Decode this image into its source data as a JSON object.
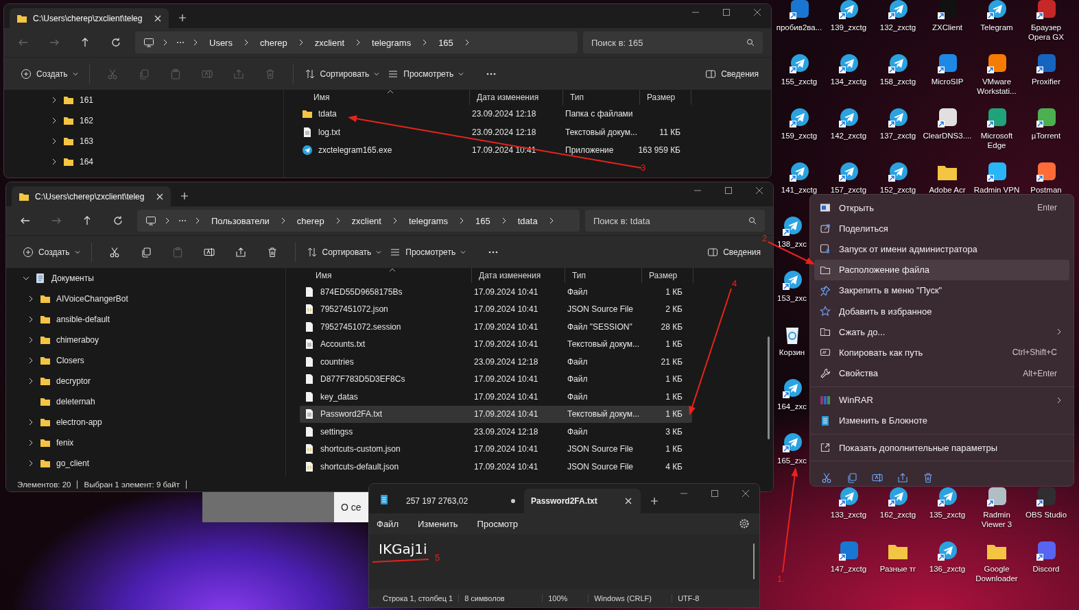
{
  "desktop": {
    "top_icons": [
      {
        "label": "пробив2ва...",
        "kind": "app",
        "color": "#1976d2"
      },
      {
        "label": "139_zxctg",
        "kind": "telegram"
      },
      {
        "label": "132_zxctg",
        "kind": "telegram"
      },
      {
        "label": "ZXClient",
        "kind": "app",
        "color": "#111111"
      },
      {
        "label": "Telegram",
        "kind": "telegram"
      },
      {
        "label": "Браузер Opera GX",
        "kind": "app",
        "color": "#c62828"
      },
      {
        "label": "155_zxctg",
        "kind": "telegram"
      },
      {
        "label": "134_zxctg",
        "kind": "telegram"
      },
      {
        "label": "158_zxctg",
        "kind": "telegram"
      },
      {
        "label": "MicroSIP",
        "kind": "app",
        "color": "#1e88e5"
      },
      {
        "label": "VMware Workstati...",
        "kind": "app",
        "color": "#f57c00"
      },
      {
        "label": "Proxifier",
        "kind": "app",
        "color": "#1565c0"
      },
      {
        "label": "159_zxctg",
        "kind": "telegram"
      },
      {
        "label": "142_zxctg",
        "kind": "telegram"
      },
      {
        "label": "137_zxctg",
        "kind": "telegram"
      },
      {
        "label": "ClearDNS3....",
        "kind": "app",
        "color": "#e0e0e0"
      },
      {
        "label": "Microsoft Edge",
        "kind": "app",
        "color": "#1fa37a"
      },
      {
        "label": "µTorrent",
        "kind": "app",
        "color": "#4caf50"
      },
      {
        "label": "141_zxctg",
        "kind": "telegram"
      },
      {
        "label": "157_zxctg",
        "kind": "telegram"
      },
      {
        "label": "152_zxctg",
        "kind": "telegram"
      },
      {
        "label": "Adobe Acr",
        "kind": "folder"
      },
      {
        "label": "Radmin VPN",
        "kind": "app",
        "color": "#29b6f6"
      },
      {
        "label": "Postman",
        "kind": "app",
        "color": "#ff6c37"
      }
    ],
    "left_icons": [
      {
        "label": "138_zxc",
        "kind": "telegram"
      },
      {
        "label": "153_zxc",
        "kind": "telegram"
      },
      {
        "label": "Корзин",
        "kind": "recycle-bin"
      },
      {
        "label": "164_zxc",
        "kind": "telegram"
      },
      {
        "label": "165_zxc",
        "kind": "telegram"
      }
    ],
    "bottom_icons": [
      {
        "label": "133_zxctg",
        "kind": "telegram"
      },
      {
        "label": "162_zxctg",
        "kind": "telegram"
      },
      {
        "label": "135_zxctg",
        "kind": "telegram"
      },
      {
        "label": "Radmin Viewer 3",
        "kind": "app",
        "color": "#b0bec5"
      },
      {
        "label": "OBS Studio",
        "kind": "app",
        "color": "#302e31"
      },
      {
        "label": "147_zxctg",
        "kind": "app",
        "color": "#1976d2"
      },
      {
        "label": "Разные тг",
        "kind": "folder"
      },
      {
        "label": "136_zxctg",
        "kind": "telegram"
      },
      {
        "label": "Google Downloader",
        "kind": "folder"
      },
      {
        "label": "Discord",
        "kind": "app",
        "color": "#5865f2"
      }
    ]
  },
  "explorer_windows": [
    {
      "tab_title": "C:\\Users\\cherep\\zxclient\\teleg",
      "nav": [
        {
          "disabled": true
        },
        {
          "disabled": true
        },
        {
          "disabled": false
        },
        {
          "disabled": false
        }
      ],
      "breadcrumbs": [
        "Users",
        "cherep",
        "zxclient",
        "telegrams",
        "165"
      ],
      "search": {
        "placeholder": "Поиск в: 165"
      },
      "toolbar": {
        "create": "Создать",
        "actions": [
          {
            "disabled": true
          },
          {
            "disabled": true
          },
          {
            "disabled": true
          },
          {
            "disabled": true
          },
          {
            "disabled": true
          },
          {
            "disabled": true
          }
        ],
        "sort": "Сортировать",
        "view": "Просмотреть",
        "details": "Сведения"
      },
      "tree": [
        {
          "label": "161",
          "kind": "folder",
          "expandable": true,
          "expanded": false
        },
        {
          "label": "162",
          "kind": "folder",
          "expandable": true,
          "expanded": false
        },
        {
          "label": "163",
          "kind": "folder",
          "expandable": true,
          "expanded": false
        },
        {
          "label": "164",
          "kind": "folder",
          "expandable": true,
          "expanded": false
        }
      ],
      "columns": [
        "Имя",
        "Дата изменения",
        "Тип",
        "Размер"
      ],
      "rows": [
        {
          "name": "tdata",
          "date": "23.09.2024 12:18",
          "type": "Папка с файлами",
          "kind": "folder",
          "selected": false
        },
        {
          "name": "log.txt",
          "date": "23.09.2024 12:18",
          "type": "Текстовый докум...",
          "size": "11 КБ",
          "kind": "text",
          "selected": false
        },
        {
          "name": "zxctelegram165.exe",
          "date": "17.09.2024 10:41",
          "type": "Приложение",
          "size": "163 959 КБ",
          "kind": "app",
          "selected": false
        }
      ]
    },
    {
      "tab_title": "C:\\Users\\cherep\\zxclient\\teleg",
      "nav": [
        {
          "disabled": false
        },
        {
          "disabled": true
        },
        {
          "disabled": false
        },
        {
          "disabled": false
        }
      ],
      "breadcrumbs": [
        "Пользователи",
        "cherep",
        "zxclient",
        "telegrams",
        "165",
        "tdata"
      ],
      "search": {
        "placeholder": "Поиск в: tdata"
      },
      "toolbar": {
        "create": "Создать",
        "actions": [
          {
            "disabled": false
          },
          {
            "disabled": false
          },
          {
            "disabled": true
          },
          {
            "disabled": false
          },
          {
            "disabled": false
          },
          {
            "disabled": false
          }
        ],
        "sort": "Сортировать",
        "view": "Просмотреть",
        "details": "Сведения"
      },
      "tree": [
        {
          "label": "Документы",
          "kind": "library",
          "expandable": true,
          "expanded": true,
          "children": [
            {
              "label": "AIVoiceChangerBot",
              "kind": "folder",
              "expandable": true
            },
            {
              "label": "ansible-default",
              "kind": "folder",
              "expandable": true
            },
            {
              "label": "chimeraboy",
              "kind": "folder",
              "expandable": true
            },
            {
              "label": "Closers",
              "kind": "folder",
              "expandable": true
            },
            {
              "label": "decryptor",
              "kind": "folder",
              "expandable": true
            },
            {
              "label": "deleternah",
              "kind": "folder",
              "expandable": false
            },
            {
              "label": "electron-app",
              "kind": "folder",
              "expandable": true
            },
            {
              "label": "fenix",
              "kind": "folder",
              "expandable": true
            },
            {
              "label": "go_client",
              "kind": "folder",
              "expandable": true
            }
          ]
        }
      ],
      "columns": [
        "Имя",
        "Дата изменения",
        "Тип",
        "Размер"
      ],
      "rows": [
        {
          "name": "874ED55D9658175Bs",
          "date": "17.09.2024 10:41",
          "type": "Файл",
          "size": "1 КБ",
          "kind": "file",
          "selected": false
        },
        {
          "name": "79527451072.json",
          "date": "17.09.2024 10:41",
          "type": "JSON Source File",
          "size": "2 КБ",
          "kind": "json",
          "selected": false
        },
        {
          "name": "79527451072.session",
          "date": "17.09.2024 10:41",
          "type": "Файл \"SESSION\"",
          "size": "28 КБ",
          "kind": "file",
          "selected": false
        },
        {
          "name": "Accounts.txt",
          "date": "17.09.2024 10:41",
          "type": "Текстовый докум...",
          "size": "1 КБ",
          "kind": "text",
          "selected": false
        },
        {
          "name": "countries",
          "date": "23.09.2024 12:18",
          "type": "Файл",
          "size": "21 КБ",
          "kind": "file",
          "selected": false
        },
        {
          "name": "D877F783D5D3EF8Cs",
          "date": "17.09.2024 10:41",
          "type": "Файл",
          "size": "1 КБ",
          "kind": "file",
          "selected": false
        },
        {
          "name": "key_datas",
          "date": "17.09.2024 10:41",
          "type": "Файл",
          "size": "1 КБ",
          "kind": "file",
          "selected": false
        },
        {
          "name": "Password2FA.txt",
          "date": "17.09.2024 10:41",
          "type": "Текстовый докум...",
          "size": "1 КБ",
          "kind": "text",
          "selected": true
        },
        {
          "name": "settingss",
          "date": "23.09.2024 12:18",
          "type": "Файл",
          "size": "3 КБ",
          "kind": "file",
          "selected": false
        },
        {
          "name": "shortcuts-custom.json",
          "date": "17.09.2024 10:41",
          "type": "JSON Source File",
          "size": "1 КБ",
          "kind": "json",
          "selected": false
        },
        {
          "name": "shortcuts-default.json",
          "date": "17.09.2024 10:41",
          "type": "JSON Source File",
          "size": "4 КБ",
          "kind": "json",
          "selected": false
        }
      ],
      "status_bar": [
        "Элементов: 20",
        "Выбран 1 элемент: 9 байт"
      ]
    }
  ],
  "dialog_fragment": {
    "button": "О се"
  },
  "notepad": {
    "tabs": [
      {
        "title": "257 197 2763,02",
        "unsaved": true,
        "selected": false
      },
      {
        "title": "Password2FA.txt",
        "unsaved": false,
        "selected": true
      }
    ],
    "menu": [
      "Файл",
      "Изменить",
      "Просмотр"
    ],
    "text": "IKGaj1i",
    "status_bar": [
      "Строка 1, столбец 1",
      "8 символов",
      "100%",
      "Windows (CRLF)",
      "UTF-8"
    ]
  },
  "context_menu": {
    "sections": [
      [
        {
          "label": "Открыть",
          "shortcut": "Enter",
          "submenu": false,
          "selected": false
        },
        {
          "label": "Поделиться",
          "submenu": false,
          "selected": false
        },
        {
          "label": "Запуск от имени администратора",
          "submenu": false,
          "selected": false
        },
        {
          "label": "Расположение файла",
          "submenu": false,
          "selected": true
        },
        {
          "label": "Закрепить в меню \"Пуск\"",
          "submenu": false,
          "selected": false
        },
        {
          "label": "Добавить в избранное",
          "submenu": false,
          "selected": false
        },
        {
          "label": "Сжать до...",
          "submenu": true,
          "selected": false
        },
        {
          "label": "Копировать как путь",
          "shortcut": "Ctrl+Shift+C",
          "submenu": false,
          "selected": false
        },
        {
          "label": "Свойства",
          "shortcut": "Alt+Enter",
          "submenu": false,
          "selected": false
        }
      ],
      [
        {
          "label": "WinRAR",
          "submenu": true,
          "selected": false
        },
        {
          "label": "Изменить в Блокноте",
          "submenu": false,
          "selected": false
        }
      ],
      [
        {
          "label": "Показать дополнительные параметры",
          "submenu": false,
          "selected": false
        }
      ]
    ]
  },
  "annotations": [
    {
      "label": "1.",
      "kind": "arrow"
    },
    {
      "label": "2",
      "kind": "arrow"
    },
    {
      "label": "3",
      "kind": "arrow"
    },
    {
      "label": "4",
      "kind": "arrow"
    },
    {
      "label": "5",
      "kind": "underline"
    }
  ]
}
